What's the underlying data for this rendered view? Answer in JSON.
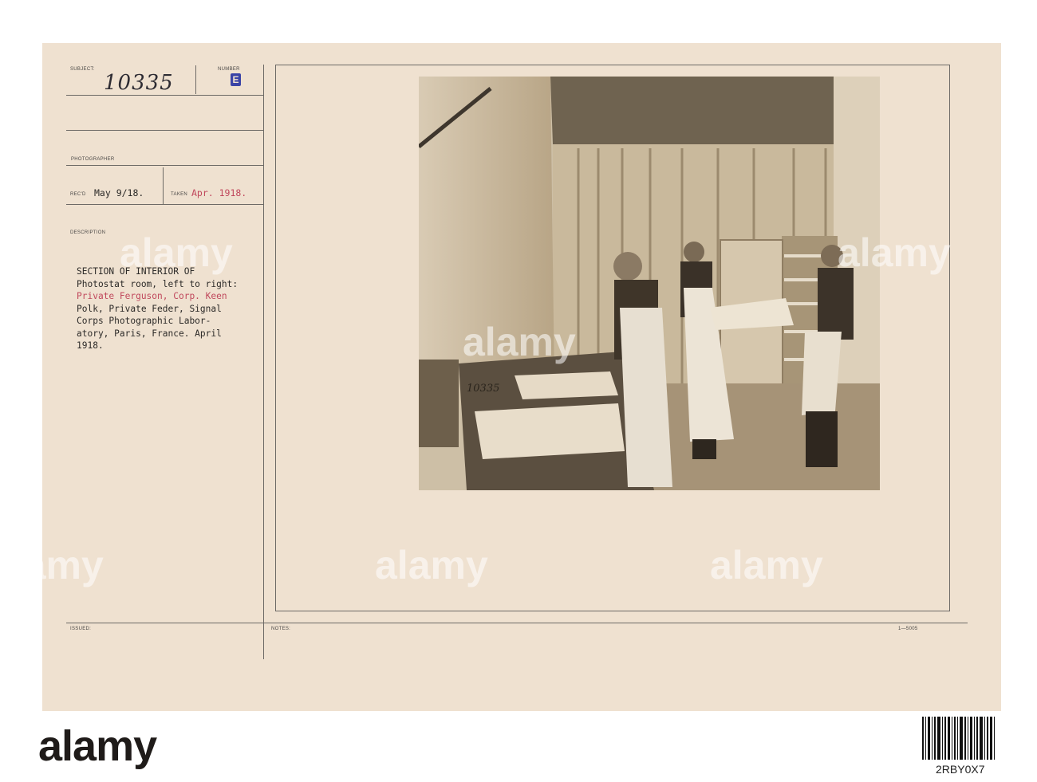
{
  "record_card": {
    "subject_label": "SUBJECT:",
    "subject_value": "10335",
    "number_label": "NUMBER",
    "number_value": "E",
    "photographer_label": "PHOTOGRAPHER",
    "recd_label": "REC'D",
    "recd_value": "May 9/18.",
    "taken_label": "TAKEN",
    "taken_value": "Apr. 1918.",
    "description_label": "DESCRIPTION",
    "description_lines": [
      {
        "text": "SECTION OF INTERIOR OF",
        "color": "#2c2a28"
      },
      {
        "text": "Photostat room, left to right:",
        "color": "#2c2a28"
      },
      {
        "text": "Private Ferguson, Corp. Keen",
        "color": "#c0485c"
      },
      {
        "text": "Polk, Private Feder, Signal",
        "color": "#2c2a28"
      },
      {
        "text": "Corps Photographic Labor-",
        "color": "#2c2a28"
      },
      {
        "text": "atory, Paris, France. April",
        "color": "#2c2a28"
      },
      {
        "text": "1918.",
        "color": "#2c2a28"
      }
    ],
    "issued_label": "ISSUED:",
    "notes_label": "NOTES:",
    "form_number": "1—5005",
    "photo_negative_number": "10335"
  },
  "watermark_text": "alamy",
  "footer": {
    "logo": "alamy",
    "image_id": "2RBY0X7"
  },
  "colors": {
    "card": "#efe1d0",
    "typed_red": "#c0485c",
    "stamp_blue": "#3a43a6"
  }
}
